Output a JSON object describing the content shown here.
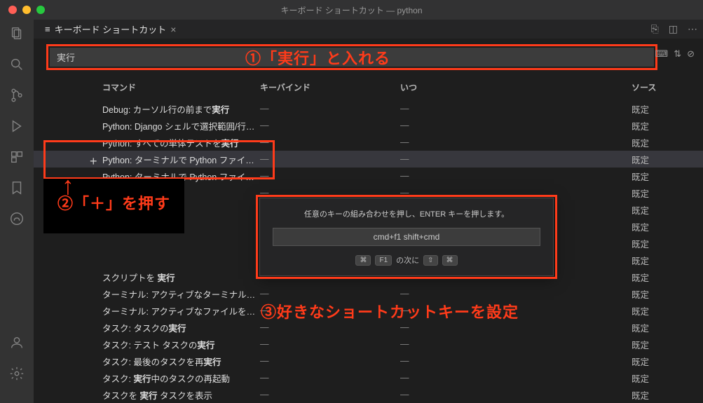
{
  "titlebar": {
    "title": "キーボード ショートカット — python"
  },
  "tab": {
    "label": "キーボード ショートカット"
  },
  "search": {
    "value": "実行"
  },
  "columns": {
    "command": "コマンド",
    "keybind": "キーバインド",
    "when": "いつ",
    "source": "ソース"
  },
  "dash": "—",
  "source_default": "既定",
  "rows": [
    {
      "prefix": "Debug: カーソル行の前まで",
      "bold": "実行"
    },
    {
      "prefix": "Python: Django シェルで選択範囲/行を ",
      "bold": "実行"
    },
    {
      "prefix": "Python: すべての単体テストを",
      "bold": "実行"
    },
    {
      "prefix": "Python: ターミナルで Python ファイルを",
      "bold": "実行",
      "selected": true
    },
    {
      "prefix": "Python: ターミナルで Python ファイルを",
      "bold": "実行"
    },
    {
      "prefix": "",
      "bold": ""
    },
    {
      "prefix": "",
      "bold": ""
    },
    {
      "prefix": "",
      "bold": ""
    },
    {
      "prefix": "",
      "bold": ""
    },
    {
      "prefix": "",
      "bold": ""
    },
    {
      "prefix": "スクリプトを ",
      "bold": "実行"
    },
    {
      "prefix": "ターミナル: アクティブなターミナルで選択し…",
      "bold": ""
    },
    {
      "prefix": "ターミナル: アクティブなファイルをアクティ…",
      "bold": ""
    },
    {
      "prefix": "タスク: タスクの",
      "bold": "実行"
    },
    {
      "prefix": "タスク: テスト タスクの",
      "bold": "実行"
    },
    {
      "prefix": "タスク: 最後のタスクを再",
      "bold": "実行"
    },
    {
      "prefix": "タスク: ",
      "bold": "実行",
      "suffix": "中のタスクの再起動"
    },
    {
      "prefix": "タスクを ",
      "bold": "実行",
      "suffix": " タスクを表示"
    }
  ],
  "dialog": {
    "message": "任意のキーの組み合わせを押し、ENTER キーを押します。",
    "input": "cmd+f1 shift+cmd",
    "k1": "⌘",
    "k2": "F1",
    "mid": "の次に",
    "k3": "⇧",
    "k4": "⌘"
  },
  "annotations": {
    "a1": "①「実行」と入れる",
    "a2": "②「＋」を押す",
    "a3": "③好きなショートカットキーを設定"
  }
}
